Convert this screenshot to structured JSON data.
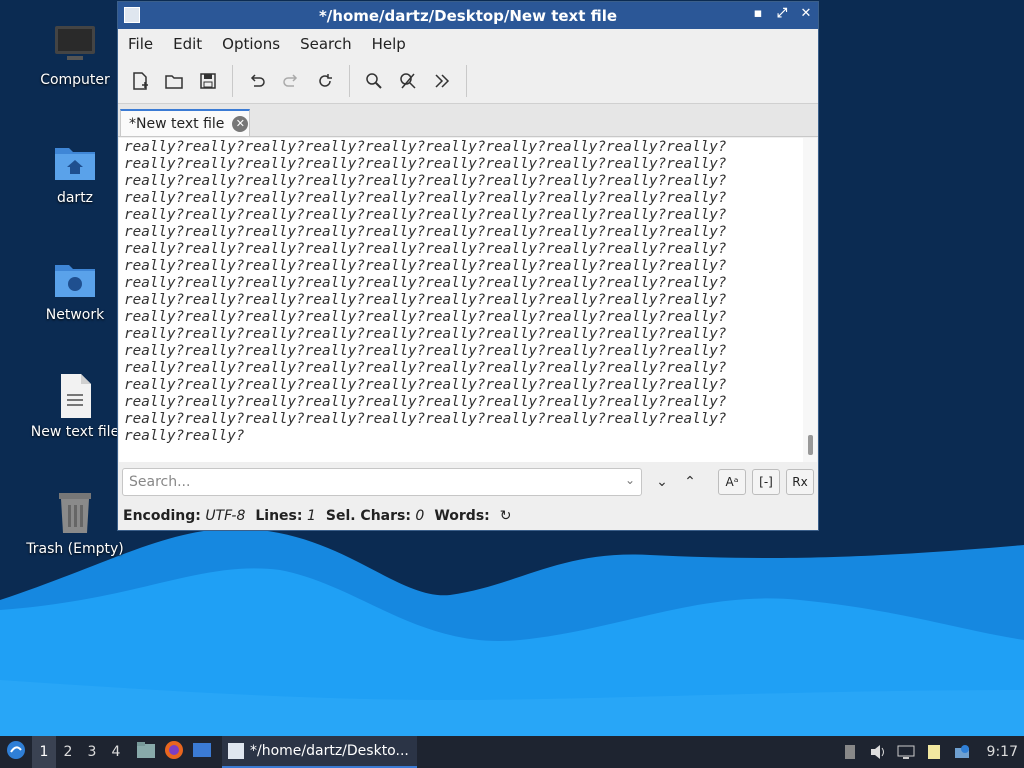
{
  "desktop": {
    "icons": [
      {
        "label": "Computer"
      },
      {
        "label": "dartz"
      },
      {
        "label": "Network"
      },
      {
        "label": "New text file"
      },
      {
        "label": "Trash (Empty)"
      }
    ]
  },
  "window": {
    "title": "*/home/dartz/Desktop/New text file",
    "controls": {
      "minimize": "▪",
      "maximize": "⤢",
      "close": "✕"
    },
    "menu": [
      "File",
      "Edit",
      "Options",
      "Search",
      "Help"
    ],
    "tab": {
      "label": "*New text file",
      "close": "✕"
    },
    "editor": {
      "lines": [
        "really?really?really?really?really?really?really?really?really?really?",
        "really?really?really?really?really?really?really?really?really?really?",
        "really?really?really?really?really?really?really?really?really?really?",
        "really?really?really?really?really?really?really?really?really?really?",
        "really?really?really?really?really?really?really?really?really?really?",
        "really?really?really?really?really?really?really?really?really?really?",
        "really?really?really?really?really?really?really?really?really?really?",
        "really?really?really?really?really?really?really?really?really?really?",
        "really?really?really?really?really?really?really?really?really?really?",
        "really?really?really?really?really?really?really?really?really?really?",
        "really?really?really?really?really?really?really?really?really?really?",
        "really?really?really?really?really?really?really?really?really?really?",
        "really?really?really?really?really?really?really?really?really?really?",
        "really?really?really?really?really?really?really?really?really?really?",
        "really?really?really?really?really?really?really?really?really?really?",
        "really?really?really?really?really?really?really?really?really?really?",
        "really?really?really?really?really?really?really?really?really?really?",
        "really?really?"
      ]
    },
    "search": {
      "placeholder": "Search...",
      "match_case": "Aᵃ",
      "whole_word": "[-]",
      "regex": "Rx"
    },
    "status": {
      "encoding_label": "Encoding:",
      "encoding_value": "UTF-8",
      "lines_label": "Lines:",
      "lines_value": "1",
      "sel_label": "Sel. Chars:",
      "sel_value": "0",
      "words_label": "Words:"
    }
  },
  "taskbar": {
    "workspaces": [
      "1",
      "2",
      "3",
      "4"
    ],
    "task_label": "*/home/dartz/Deskto...",
    "clock": "9:17"
  },
  "colors": {
    "desktop_bg": "#0b2b52",
    "wave_light": "#1e9af0",
    "titlebar": "#2b5797",
    "taskbar": "#1e2430"
  }
}
